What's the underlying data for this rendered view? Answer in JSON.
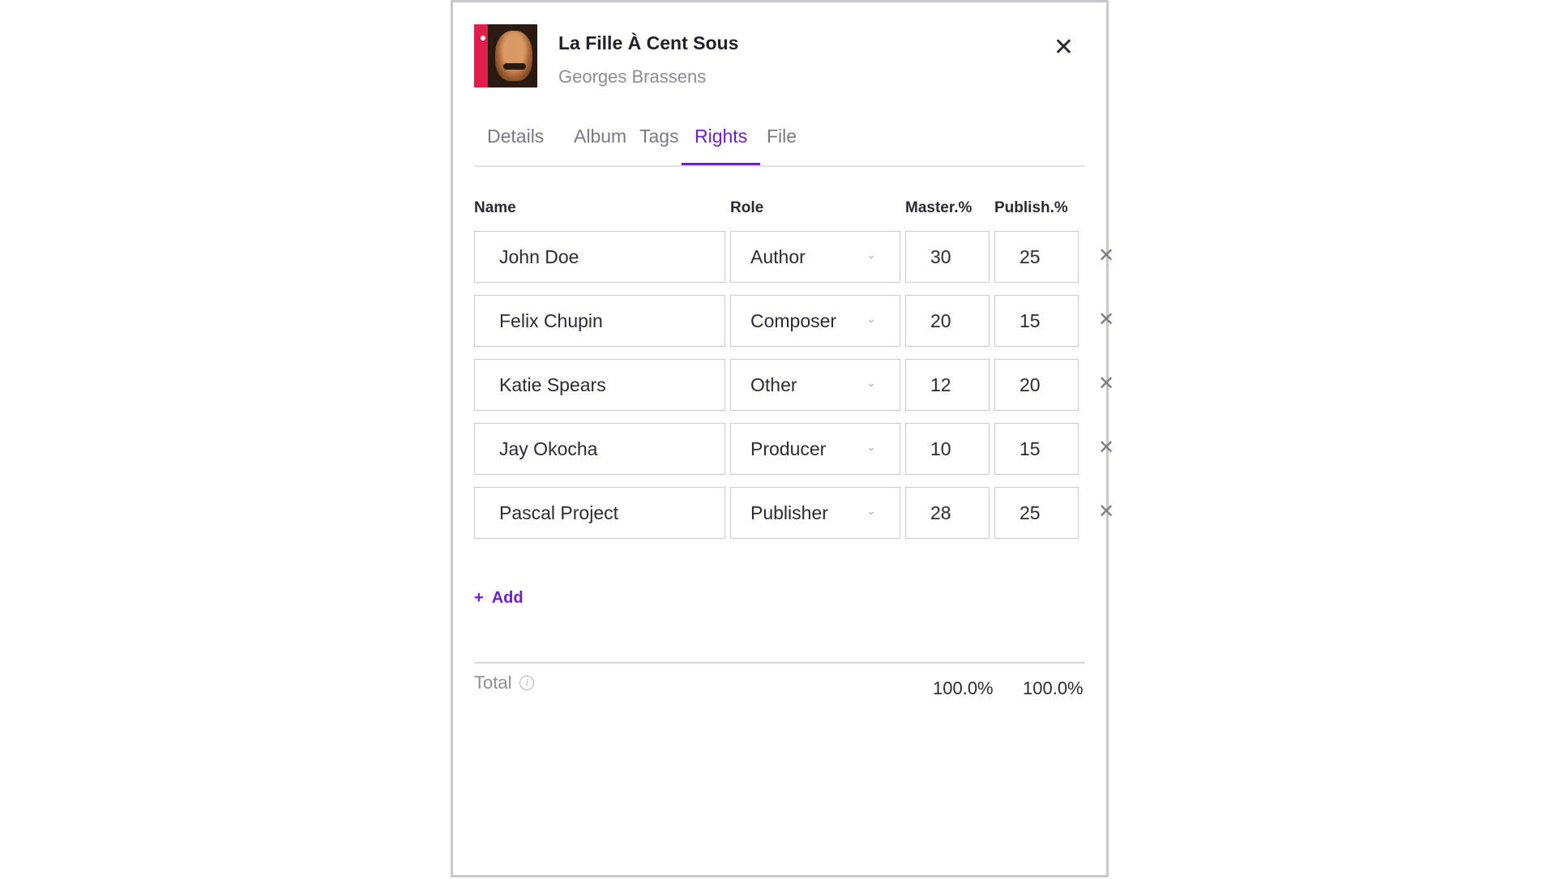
{
  "track": {
    "title": "La Fille À Cent Sous",
    "artist": "Georges Brassens"
  },
  "tabs": [
    {
      "label": "Details",
      "active": false
    },
    {
      "label": "Album",
      "active": false
    },
    {
      "label": "Tags",
      "active": false
    },
    {
      "label": "Rights",
      "active": true
    },
    {
      "label": "File",
      "active": false
    }
  ],
  "columns": {
    "name": "Name",
    "role": "Role",
    "master": "Master.%",
    "publish": "Publish.%"
  },
  "rows": [
    {
      "name": "John Doe",
      "role": "Author",
      "master": "30",
      "publish": "25"
    },
    {
      "name": "Felix Chupin",
      "role": "Composer",
      "master": "20",
      "publish": "15"
    },
    {
      "name": "Katie Spears",
      "role": "Other",
      "master": "12",
      "publish": "20"
    },
    {
      "name": "Jay Okocha",
      "role": "Producer",
      "master": "10",
      "publish": "15"
    },
    {
      "name": "Pascal Project",
      "role": "Publisher",
      "master": "28",
      "publish": "25"
    }
  ],
  "add_label": "Add",
  "total": {
    "label": "Total",
    "master": "100.0%",
    "publish": "100.0%"
  },
  "icons": {
    "close": "close-icon",
    "remove": "remove-row-icon",
    "chevron": "chevron-down-icon",
    "info": "info-icon",
    "plus": "plus-icon"
  },
  "colors": {
    "accent": "#6a1fd0",
    "border": "#c9c9cf"
  }
}
